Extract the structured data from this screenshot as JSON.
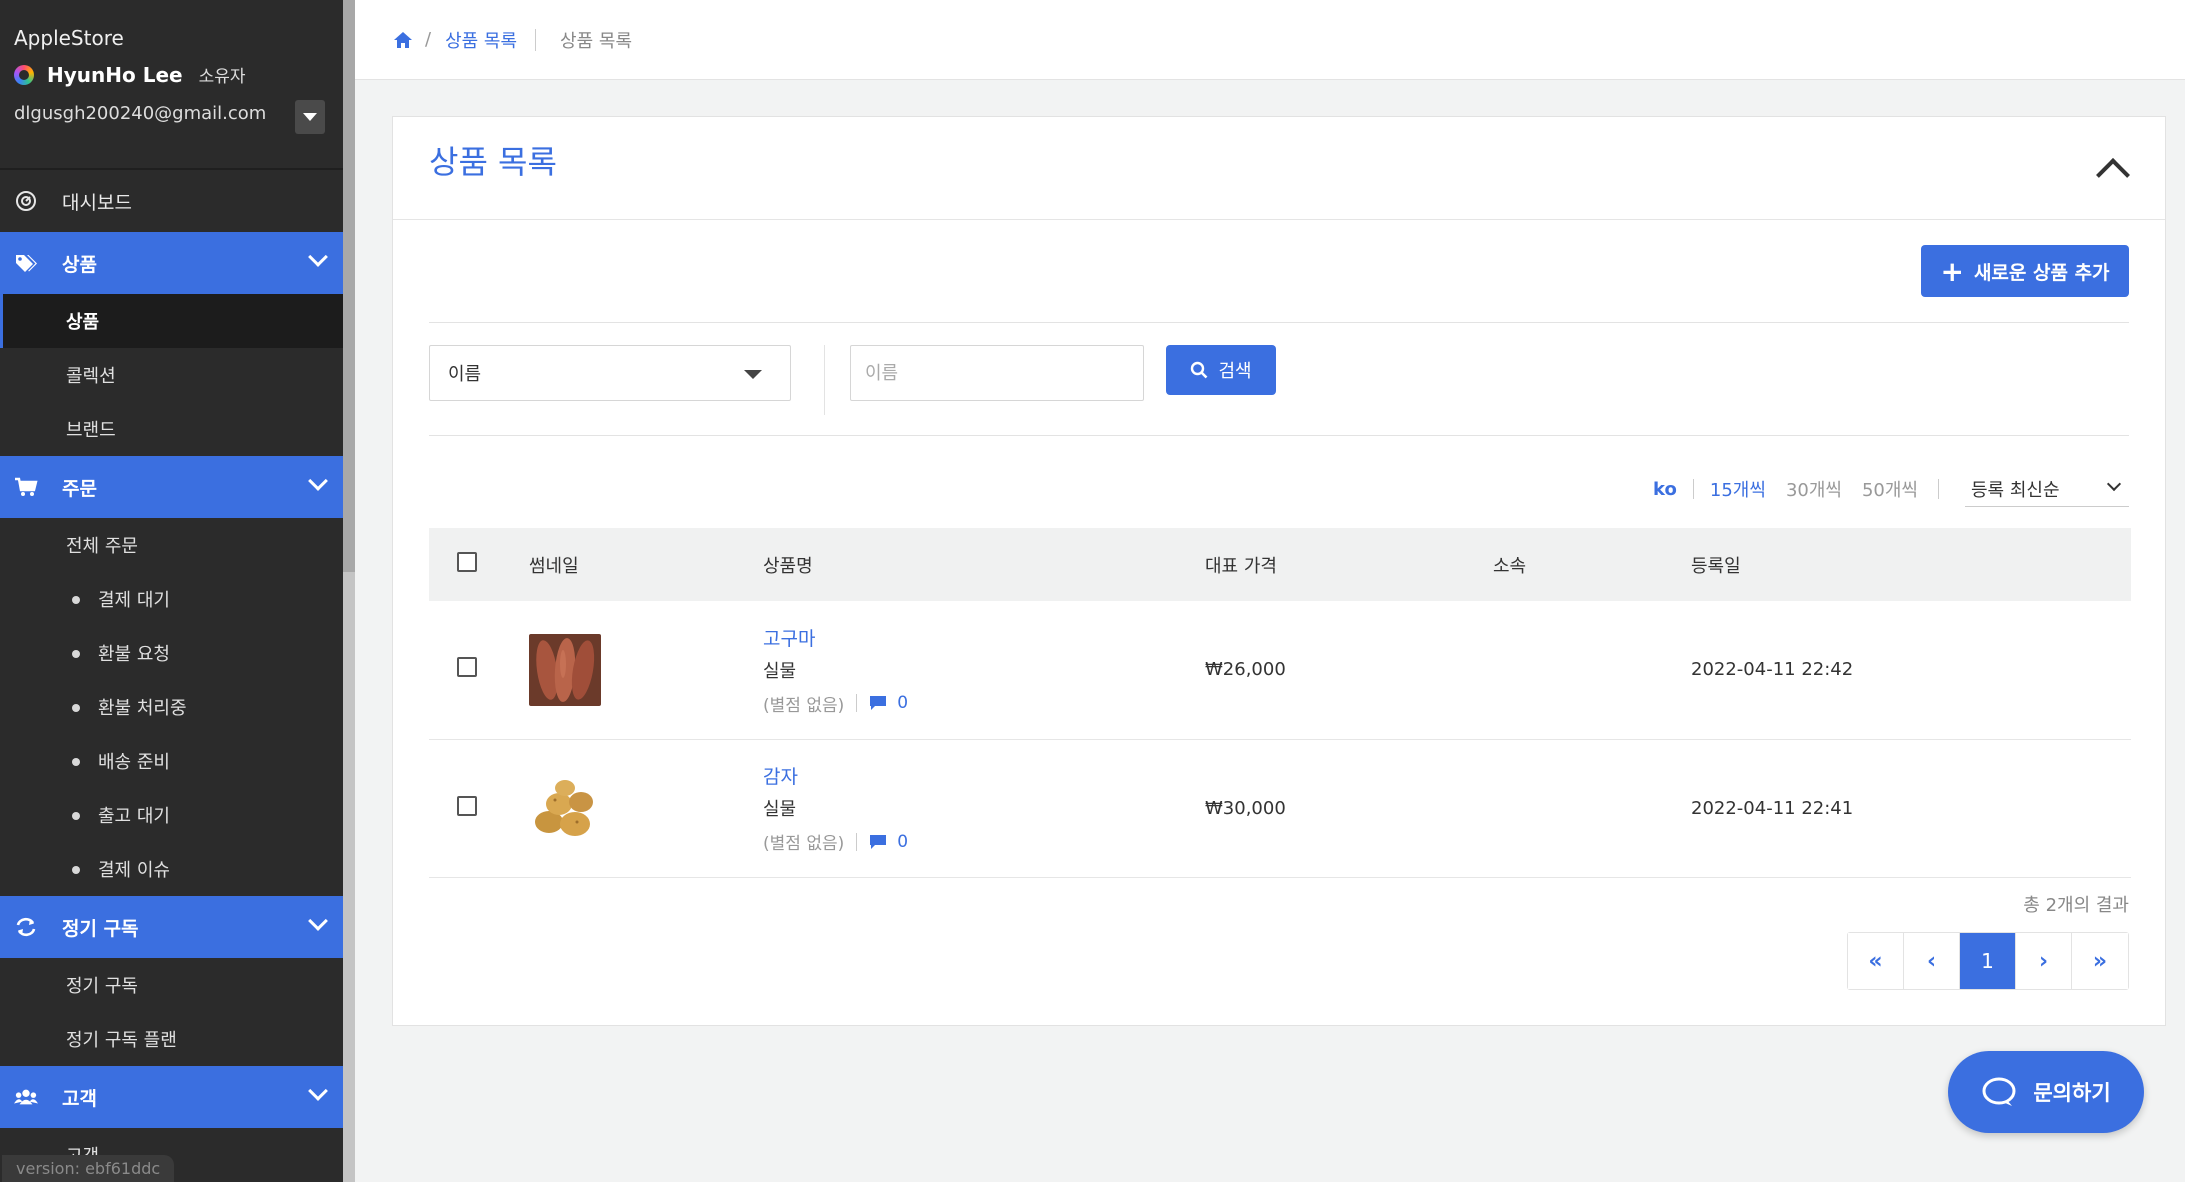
{
  "sidebar": {
    "store_name": "AppleStore",
    "user_name": "HyunHo Lee",
    "user_role": "소유자",
    "user_email": "dlgusgh200240@gmail.com",
    "dashboard_label": "대시보드",
    "sections": [
      {
        "label": "상품",
        "icon": "tags-icon",
        "items": [
          "상품",
          "콜렉션",
          "브랜드"
        ]
      },
      {
        "label": "주문",
        "icon": "cart-icon",
        "items": [
          "전체 주문",
          "결제 대기",
          "환불 요청",
          "환불 처리중",
          "배송 준비",
          "출고 대기",
          "결제 이슈"
        ]
      },
      {
        "label": "정기 구독",
        "icon": "refresh-icon",
        "items": [
          "정기 구독",
          "정기 구독 플랜"
        ]
      },
      {
        "label": "고객",
        "icon": "users-icon",
        "items": [
          "고객"
        ]
      }
    ],
    "active_item": "상품",
    "version": "version: ebf61ddc"
  },
  "breadcrumb": {
    "sep": "/",
    "link": "상품 목록",
    "current": "상품 목록"
  },
  "card": {
    "title": "상품 목록",
    "add_button": "새로운 상품 추가",
    "add_icon": "+"
  },
  "filter": {
    "field_selected": "이름",
    "search_placeholder": "이름",
    "search_button": "검색"
  },
  "list_options": {
    "lang": "ko",
    "page_sizes": [
      "15개씩",
      "30개씩",
      "50개씩"
    ],
    "active_page_size": "15개씩",
    "sort": "등록 최신순"
  },
  "table": {
    "headers": [
      "썸네일",
      "상품명",
      "대표 가격",
      "소속",
      "등록일"
    ],
    "rows": [
      {
        "name": "고구마",
        "type": "실물",
        "rating": "(별점 없음)",
        "comments": "0",
        "price": "₩26,000",
        "affiliation": "",
        "date": "2022-04-11 22:42"
      },
      {
        "name": "감자",
        "type": "실물",
        "rating": "(별점 없음)",
        "comments": "0",
        "price": "₩30,000",
        "affiliation": "",
        "date": "2022-04-11 22:41"
      }
    ]
  },
  "pagination": {
    "total": "총 2개의 결과",
    "first": "«",
    "prev": "‹",
    "current": "1",
    "next": "›",
    "last": "»"
  },
  "help_button": "문의하기",
  "colors": {
    "accent": "#3b6fe0",
    "sidebar_bg": "#2b2b2b",
    "page_bg": "#f2f3f3"
  }
}
